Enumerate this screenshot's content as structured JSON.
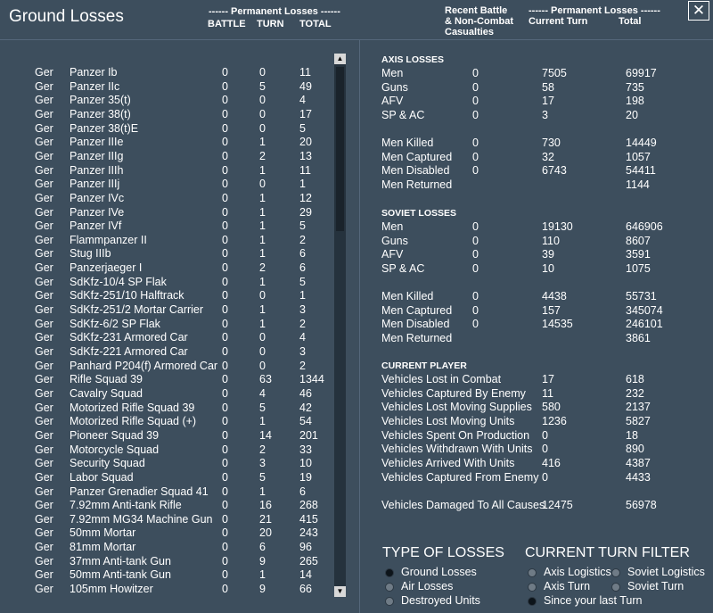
{
  "title": "Ground Losses",
  "close_label": "✕",
  "left_header": {
    "group": "------ Permanent Losses ------",
    "battle": "BATTLE",
    "turn": "TURN",
    "total": "TOTAL"
  },
  "right_header": {
    "recent": "Recent Battle",
    "noncombat": "& Non-Combat",
    "casualties": "Casualties",
    "group": "------ Permanent Losses ------",
    "current": "Current Turn",
    "total": "Total"
  },
  "units": [
    {
      "nation": "Ger",
      "name": "Panzer Ib",
      "battle": "0",
      "turn": "0",
      "total": "11"
    },
    {
      "nation": "Ger",
      "name": "Panzer IIc",
      "battle": "0",
      "turn": "5",
      "total": "49"
    },
    {
      "nation": "Ger",
      "name": "Panzer 35(t)",
      "battle": "0",
      "turn": "0",
      "total": "4"
    },
    {
      "nation": "Ger",
      "name": "Panzer 38(t)",
      "battle": "0",
      "turn": "0",
      "total": "17"
    },
    {
      "nation": "Ger",
      "name": "Panzer 38(t)E",
      "battle": "0",
      "turn": "0",
      "total": "5"
    },
    {
      "nation": "Ger",
      "name": "Panzer IIIe",
      "battle": "0",
      "turn": "1",
      "total": "20"
    },
    {
      "nation": "Ger",
      "name": "Panzer IIIg",
      "battle": "0",
      "turn": "2",
      "total": "13"
    },
    {
      "nation": "Ger",
      "name": "Panzer IIIh",
      "battle": "0",
      "turn": "1",
      "total": "11"
    },
    {
      "nation": "Ger",
      "name": "Panzer IIIj",
      "battle": "0",
      "turn": "0",
      "total": "1"
    },
    {
      "nation": "Ger",
      "name": "Panzer IVc",
      "battle": "0",
      "turn": "1",
      "total": "12"
    },
    {
      "nation": "Ger",
      "name": "Panzer IVe",
      "battle": "0",
      "turn": "1",
      "total": "29"
    },
    {
      "nation": "Ger",
      "name": "Panzer IVf",
      "battle": "0",
      "turn": "1",
      "total": "5"
    },
    {
      "nation": "Ger",
      "name": "Flammpanzer II",
      "battle": "0",
      "turn": "1",
      "total": "2"
    },
    {
      "nation": "Ger",
      "name": "Stug IIIb",
      "battle": "0",
      "turn": "1",
      "total": "6"
    },
    {
      "nation": "Ger",
      "name": "Panzerjaeger I",
      "battle": "0",
      "turn": "2",
      "total": "6"
    },
    {
      "nation": "Ger",
      "name": "SdKfz-10/4 SP Flak",
      "battle": "0",
      "turn": "1",
      "total": "5"
    },
    {
      "nation": "Ger",
      "name": "SdKfz-251/10 Halftrack",
      "battle": "0",
      "turn": "0",
      "total": "1"
    },
    {
      "nation": "Ger",
      "name": "SdKfz-251/2 Mortar Carrier",
      "battle": "0",
      "turn": "1",
      "total": "3"
    },
    {
      "nation": "Ger",
      "name": "SdKfz-6/2 SP Flak",
      "battle": "0",
      "turn": "1",
      "total": "2"
    },
    {
      "nation": "Ger",
      "name": "SdKfz-231 Armored Car",
      "battle": "0",
      "turn": "0",
      "total": "4"
    },
    {
      "nation": "Ger",
      "name": "SdKfz-221 Armored Car",
      "battle": "0",
      "turn": "0",
      "total": "3"
    },
    {
      "nation": "Ger",
      "name": "Panhard P204(f) Armored Car",
      "battle": "0",
      "turn": "0",
      "total": "2"
    },
    {
      "nation": "Ger",
      "name": "Rifle Squad 39",
      "battle": "0",
      "turn": "63",
      "total": "1344"
    },
    {
      "nation": "Ger",
      "name": "Cavalry Squad",
      "battle": "0",
      "turn": "4",
      "total": "46"
    },
    {
      "nation": "Ger",
      "name": "Motorized Rifle Squad 39",
      "battle": "0",
      "turn": "5",
      "total": "42"
    },
    {
      "nation": "Ger",
      "name": "Motorized Rifle Squad (+)",
      "battle": "0",
      "turn": "1",
      "total": "54"
    },
    {
      "nation": "Ger",
      "name": "Pioneer Squad 39",
      "battle": "0",
      "turn": "14",
      "total": "201"
    },
    {
      "nation": "Ger",
      "name": "Motorcycle Squad",
      "battle": "0",
      "turn": "2",
      "total": "33"
    },
    {
      "nation": "Ger",
      "name": "Security Squad",
      "battle": "0",
      "turn": "3",
      "total": "10"
    },
    {
      "nation": "Ger",
      "name": "Labor Squad",
      "battle": "0",
      "turn": "5",
      "total": "19"
    },
    {
      "nation": "Ger",
      "name": "Panzer Grenadier Squad 41",
      "battle": "0",
      "turn": "1",
      "total": "6"
    },
    {
      "nation": "Ger",
      "name": "7.92mm Anti-tank Rifle",
      "battle": "0",
      "turn": "16",
      "total": "268"
    },
    {
      "nation": "Ger",
      "name": "7.92mm MG34 Machine Gun",
      "battle": "0",
      "turn": "21",
      "total": "415"
    },
    {
      "nation": "Ger",
      "name": "50mm Mortar",
      "battle": "0",
      "turn": "20",
      "total": "243"
    },
    {
      "nation": "Ger",
      "name": "81mm Mortar",
      "battle": "0",
      "turn": "6",
      "total": "96"
    },
    {
      "nation": "Ger",
      "name": "37mm Anti-tank Gun",
      "battle": "0",
      "turn": "9",
      "total": "265"
    },
    {
      "nation": "Ger",
      "name": "50mm Anti-tank Gun",
      "battle": "0",
      "turn": "1",
      "total": "14"
    },
    {
      "nation": "Ger",
      "name": "105mm Howitzer",
      "battle": "0",
      "turn": "9",
      "total": "66"
    }
  ],
  "axis": {
    "heading": "AXIS LOSSES",
    "rows": [
      {
        "label": "Men",
        "battle": "0",
        "current": "7505",
        "total": "69917"
      },
      {
        "label": "Guns",
        "battle": "0",
        "current": "58",
        "total": "735"
      },
      {
        "label": "AFV",
        "battle": "0",
        "current": "17",
        "total": "198"
      },
      {
        "label": "SP & AC",
        "battle": "0",
        "current": "3",
        "total": "20"
      }
    ],
    "rows2": [
      {
        "label": "Men Killed",
        "battle": "0",
        "current": "730",
        "total": "14449"
      },
      {
        "label": "Men Captured",
        "battle": "0",
        "current": "32",
        "total": "1057"
      },
      {
        "label": "Men Disabled",
        "battle": "0",
        "current": "6743",
        "total": "54411"
      },
      {
        "label": "Men Returned",
        "battle": "",
        "current": "",
        "total": "1144"
      }
    ]
  },
  "soviet": {
    "heading": "SOVIET LOSSES",
    "rows": [
      {
        "label": "Men",
        "battle": "0",
        "current": "19130",
        "total": "646906"
      },
      {
        "label": "Guns",
        "battle": "0",
        "current": "110",
        "total": "8607"
      },
      {
        "label": "AFV",
        "battle": "0",
        "current": "39",
        "total": "3591"
      },
      {
        "label": "SP & AC",
        "battle": "0",
        "current": "10",
        "total": "1075"
      }
    ],
    "rows2": [
      {
        "label": "Men Killed",
        "battle": "0",
        "current": "4438",
        "total": "55731"
      },
      {
        "label": "Men Captured",
        "battle": "0",
        "current": "157",
        "total": "345074"
      },
      {
        "label": "Men Disabled",
        "battle": "0",
        "current": "14535",
        "total": "246101"
      },
      {
        "label": "Men Returned",
        "battle": "",
        "current": "",
        "total": "3861"
      }
    ]
  },
  "player": {
    "heading": "CURRENT PLAYER",
    "rows": [
      {
        "label": "Vehicles Lost in Combat",
        "current": "17",
        "total": "618"
      },
      {
        "label": "Vehicles Captured By Enemy",
        "current": "11",
        "total": "232"
      },
      {
        "label": "Vehicles Lost Moving Supplies",
        "current": "580",
        "total": "2137"
      },
      {
        "label": "Vehicles Lost Moving Units",
        "current": "1236",
        "total": "5827"
      },
      {
        "label": "Vehicles Spent On Production",
        "current": "0",
        "total": "18"
      },
      {
        "label": "Vehicles Withdrawn With Units",
        "current": "0",
        "total": "890"
      },
      {
        "label": "Vehicles Arrived With Units",
        "current": "416",
        "total": "4387"
      },
      {
        "label": "Vehicles Captured From Enemy",
        "current": "0",
        "total": "4433"
      }
    ],
    "damaged": {
      "label": "Vehicles Damaged To All Causes",
      "current": "12475",
      "total": "56978"
    }
  },
  "type_filter": {
    "heading": "TYPE OF LOSSES",
    "options": [
      "Ground Losses",
      "Air Losses",
      "Destroyed Units"
    ],
    "selected": 0
  },
  "turn_filter": {
    "heading": "CURRENT TURN FILTER",
    "options": [
      "Axis Logistics",
      "Soviet Logistics",
      "Axis Turn",
      "Soviet Turn",
      "Since your last Turn"
    ],
    "selected": 4
  },
  "colors": {
    "background": "#3d4e5d",
    "text": "#ffffff",
    "scroll_track": "#25323d"
  }
}
